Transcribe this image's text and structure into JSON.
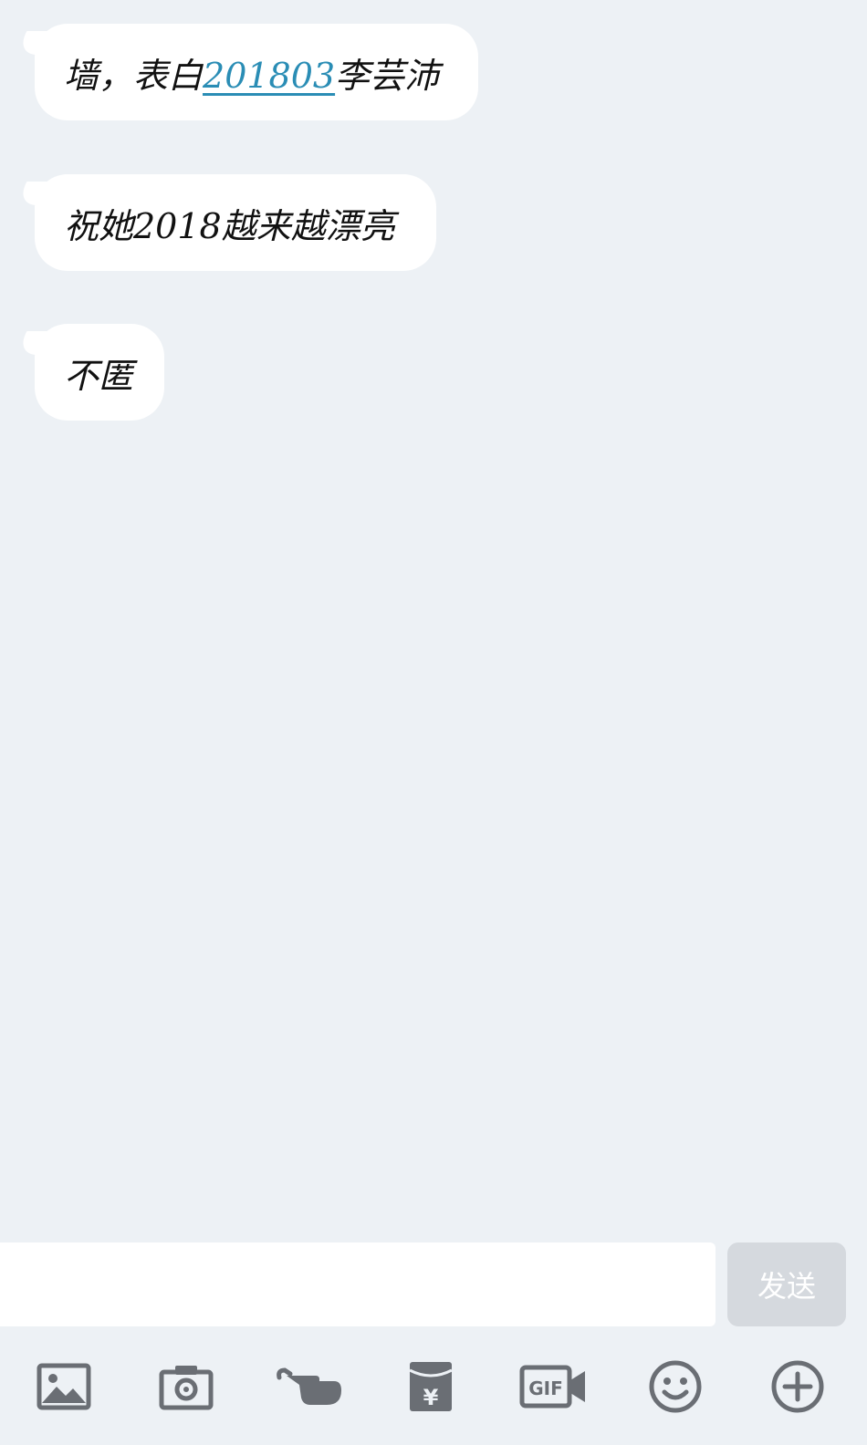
{
  "messages": [
    {
      "prefix": "墙，表白",
      "link": "201803",
      "suffix": "李芸沛"
    },
    {
      "text": "祝她2018越来越漂亮"
    },
    {
      "text": "不匿"
    }
  ],
  "composer": {
    "input_value": "",
    "input_placeholder": "",
    "send_label": "发送"
  },
  "toolbar": {
    "icons": [
      "image-icon",
      "camera-icon",
      "poke-hand-icon",
      "red-packet-icon",
      "gif-icon",
      "emoji-icon",
      "plus-icon"
    ],
    "gif_text": "GIF",
    "yen_text": "¥"
  },
  "colors": {
    "background": "#edf1f5",
    "bubble": "#ffffff",
    "link": "#2a8db5",
    "icon": "#6a6e74",
    "send_disabled": "#d5d9de"
  }
}
